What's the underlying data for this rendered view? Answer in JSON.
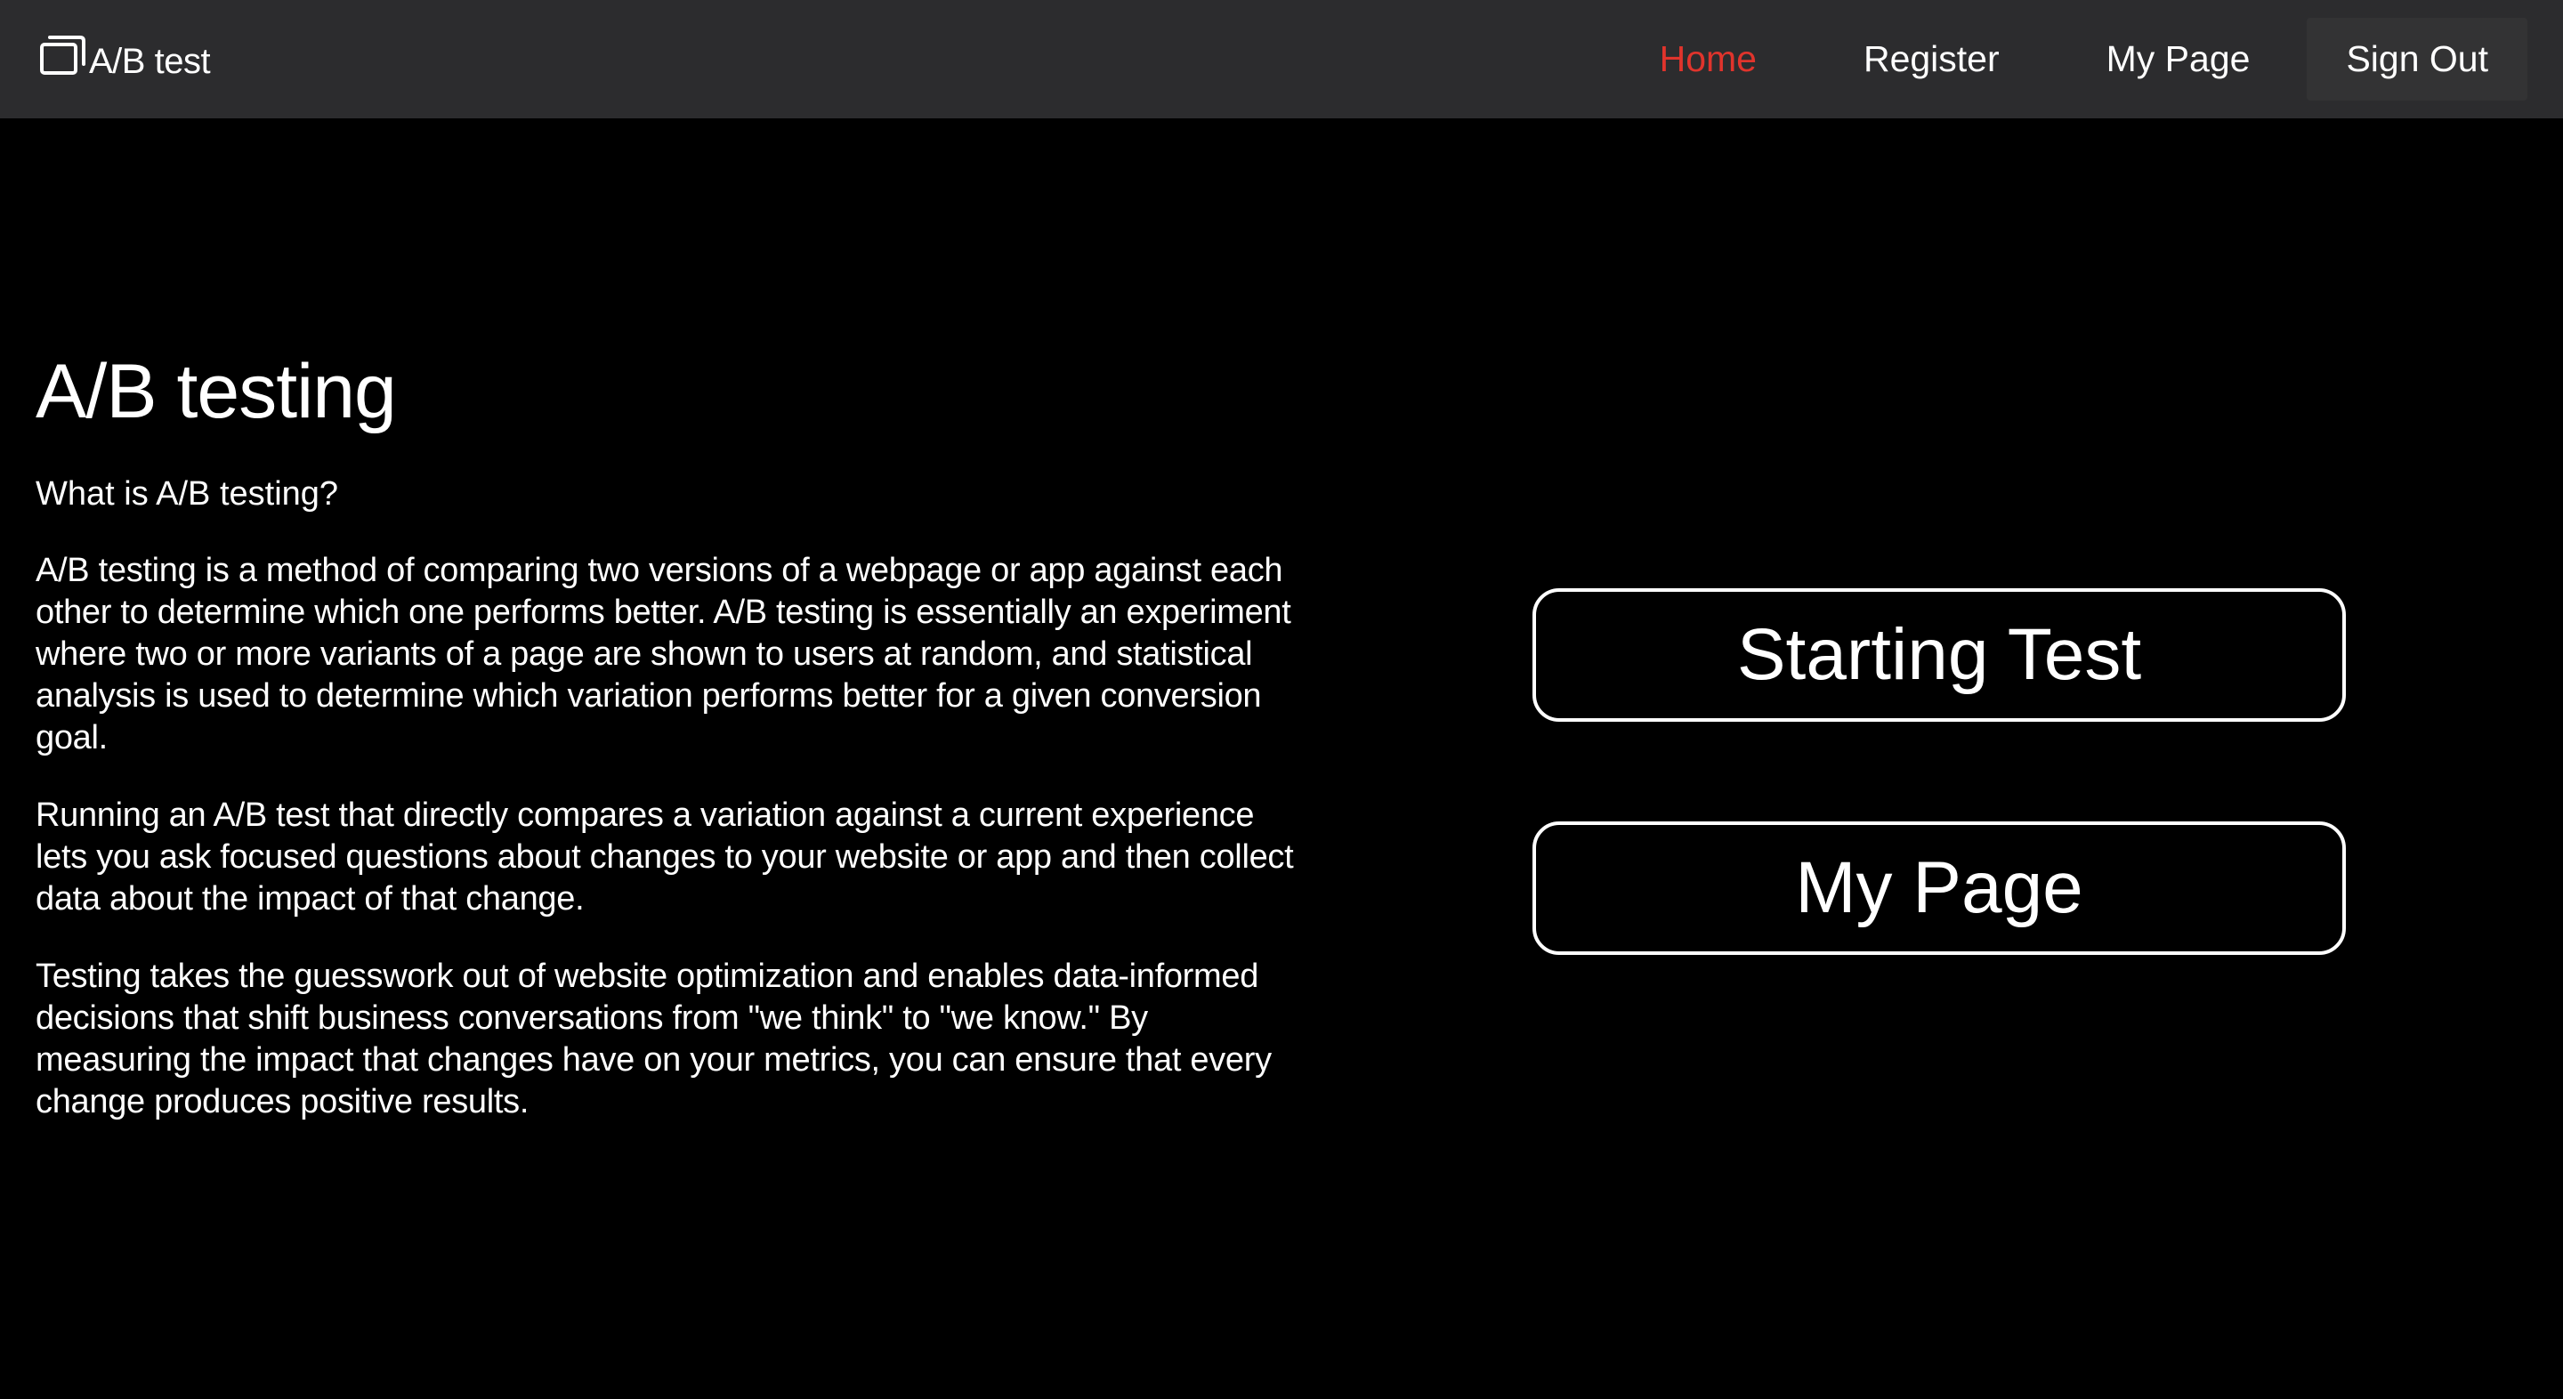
{
  "navbar": {
    "brand": {
      "icon": "window-icon",
      "label": "A/B test"
    },
    "links": [
      {
        "label": "Home",
        "active": true,
        "color": "#e0342c"
      },
      {
        "label": "Register",
        "active": false
      },
      {
        "label": "My Page",
        "active": false
      },
      {
        "label": "Sign Out",
        "active": false
      }
    ]
  },
  "main": {
    "title": "A/B testing",
    "subtitle": "What is A/B testing?",
    "paragraphs": [
      "A/B testing is a method of comparing two versions of a webpage or app against each other to determine which one performs better. A/B testing is essentially an experiment where two or more variants of a page are shown to users at random, and statistical analysis is used to determine which variation performs better for a given conversion goal.",
      "Running an A/B test that directly compares a variation against a current experience lets you ask focused questions about changes to your website or app and then collect data about the impact of that change.",
      "Testing takes the guesswork out of website optimization and enables data-informed decisions that shift business conversations from \"we think\" to \"we know.\" By measuring the impact that changes have on your metrics, you can ensure that every change produces positive results."
    ]
  },
  "actions": {
    "start_test_label": "Starting Test",
    "my_page_label": "My Page"
  },
  "colors": {
    "background": "#000000",
    "navbar": "#2c2c2e",
    "accent": "#e0342c",
    "text": "#ffffff"
  }
}
